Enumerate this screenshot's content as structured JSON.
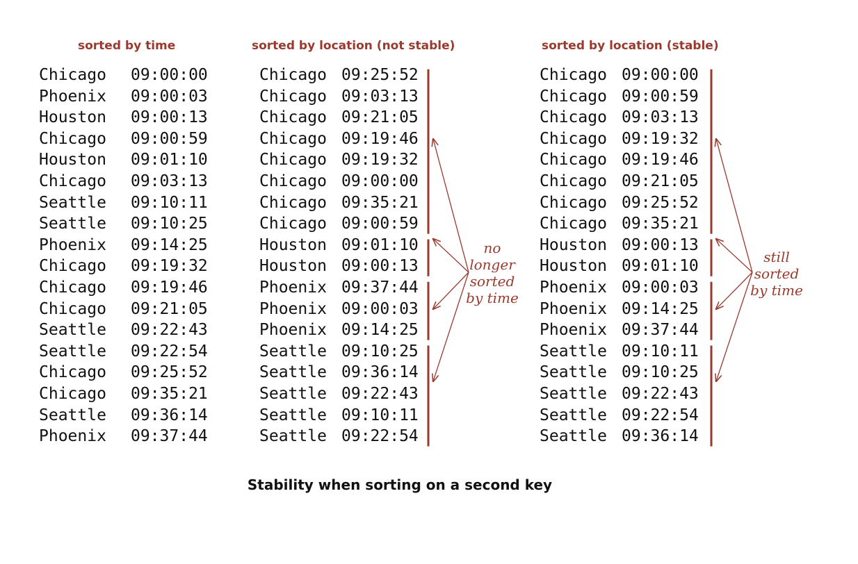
{
  "columns": [
    {
      "title": "sorted by time",
      "records": [
        {
          "city": "Chicago",
          "time": "09:00:00"
        },
        {
          "city": "Phoenix",
          "time": "09:00:03"
        },
        {
          "city": "Houston",
          "time": "09:00:13"
        },
        {
          "city": "Chicago",
          "time": "09:00:59"
        },
        {
          "city": "Houston",
          "time": "09:01:10"
        },
        {
          "city": "Chicago",
          "time": "09:03:13"
        },
        {
          "city": "Seattle",
          "time": "09:10:11"
        },
        {
          "city": "Seattle",
          "time": "09:10:25"
        },
        {
          "city": "Phoenix",
          "time": "09:14:25"
        },
        {
          "city": "Chicago",
          "time": "09:19:32"
        },
        {
          "city": "Chicago",
          "time": "09:19:46"
        },
        {
          "city": "Chicago",
          "time": "09:21:05"
        },
        {
          "city": "Seattle",
          "time": "09:22:43"
        },
        {
          "city": "Seattle",
          "time": "09:22:54"
        },
        {
          "city": "Chicago",
          "time": "09:25:52"
        },
        {
          "city": "Chicago",
          "time": "09:35:21"
        },
        {
          "city": "Seattle",
          "time": "09:36:14"
        },
        {
          "city": "Phoenix",
          "time": "09:37:44"
        }
      ]
    },
    {
      "title": "sorted by location (not stable)",
      "records": [
        {
          "city": "Chicago",
          "time": "09:25:52"
        },
        {
          "city": "Chicago",
          "time": "09:03:13"
        },
        {
          "city": "Chicago",
          "time": "09:21:05"
        },
        {
          "city": "Chicago",
          "time": "09:19:46"
        },
        {
          "city": "Chicago",
          "time": "09:19:32"
        },
        {
          "city": "Chicago",
          "time": "09:00:00"
        },
        {
          "city": "Chicago",
          "time": "09:35:21"
        },
        {
          "city": "Chicago",
          "time": "09:00:59"
        },
        {
          "city": "Houston",
          "time": "09:01:10"
        },
        {
          "city": "Houston",
          "time": "09:00:13"
        },
        {
          "city": "Phoenix",
          "time": "09:37:44"
        },
        {
          "city": "Phoenix",
          "time": "09:00:03"
        },
        {
          "city": "Phoenix",
          "time": "09:14:25"
        },
        {
          "city": "Seattle",
          "time": "09:10:25"
        },
        {
          "city": "Seattle",
          "time": "09:36:14"
        },
        {
          "city": "Seattle",
          "time": "09:22:43"
        },
        {
          "city": "Seattle",
          "time": "09:10:11"
        },
        {
          "city": "Seattle",
          "time": "09:22:54"
        }
      ]
    },
    {
      "title": "sorted by location (stable)",
      "records": [
        {
          "city": "Chicago",
          "time": "09:00:00"
        },
        {
          "city": "Chicago",
          "time": "09:00:59"
        },
        {
          "city": "Chicago",
          "time": "09:03:13"
        },
        {
          "city": "Chicago",
          "time": "09:19:32"
        },
        {
          "city": "Chicago",
          "time": "09:19:46"
        },
        {
          "city": "Chicago",
          "time": "09:21:05"
        },
        {
          "city": "Chicago",
          "time": "09:25:52"
        },
        {
          "city": "Chicago",
          "time": "09:35:21"
        },
        {
          "city": "Houston",
          "time": "09:00:13"
        },
        {
          "city": "Houston",
          "time": "09:01:10"
        },
        {
          "city": "Phoenix",
          "time": "09:00:03"
        },
        {
          "city": "Phoenix",
          "time": "09:14:25"
        },
        {
          "city": "Phoenix",
          "time": "09:37:44"
        },
        {
          "city": "Seattle",
          "time": "09:10:11"
        },
        {
          "city": "Seattle",
          "time": "09:10:25"
        },
        {
          "city": "Seattle",
          "time": "09:22:43"
        },
        {
          "city": "Seattle",
          "time": "09:22:54"
        },
        {
          "city": "Seattle",
          "time": "09:36:14"
        }
      ]
    }
  ],
  "annotations": {
    "not_stable": [
      "no",
      "longer",
      "sorted",
      "by time"
    ],
    "stable": [
      "still",
      "sorted",
      "by time"
    ]
  },
  "caption": "Stability when sorting on a second key",
  "colors": {
    "accent": "#9a3a2e",
    "text": "#111111"
  }
}
